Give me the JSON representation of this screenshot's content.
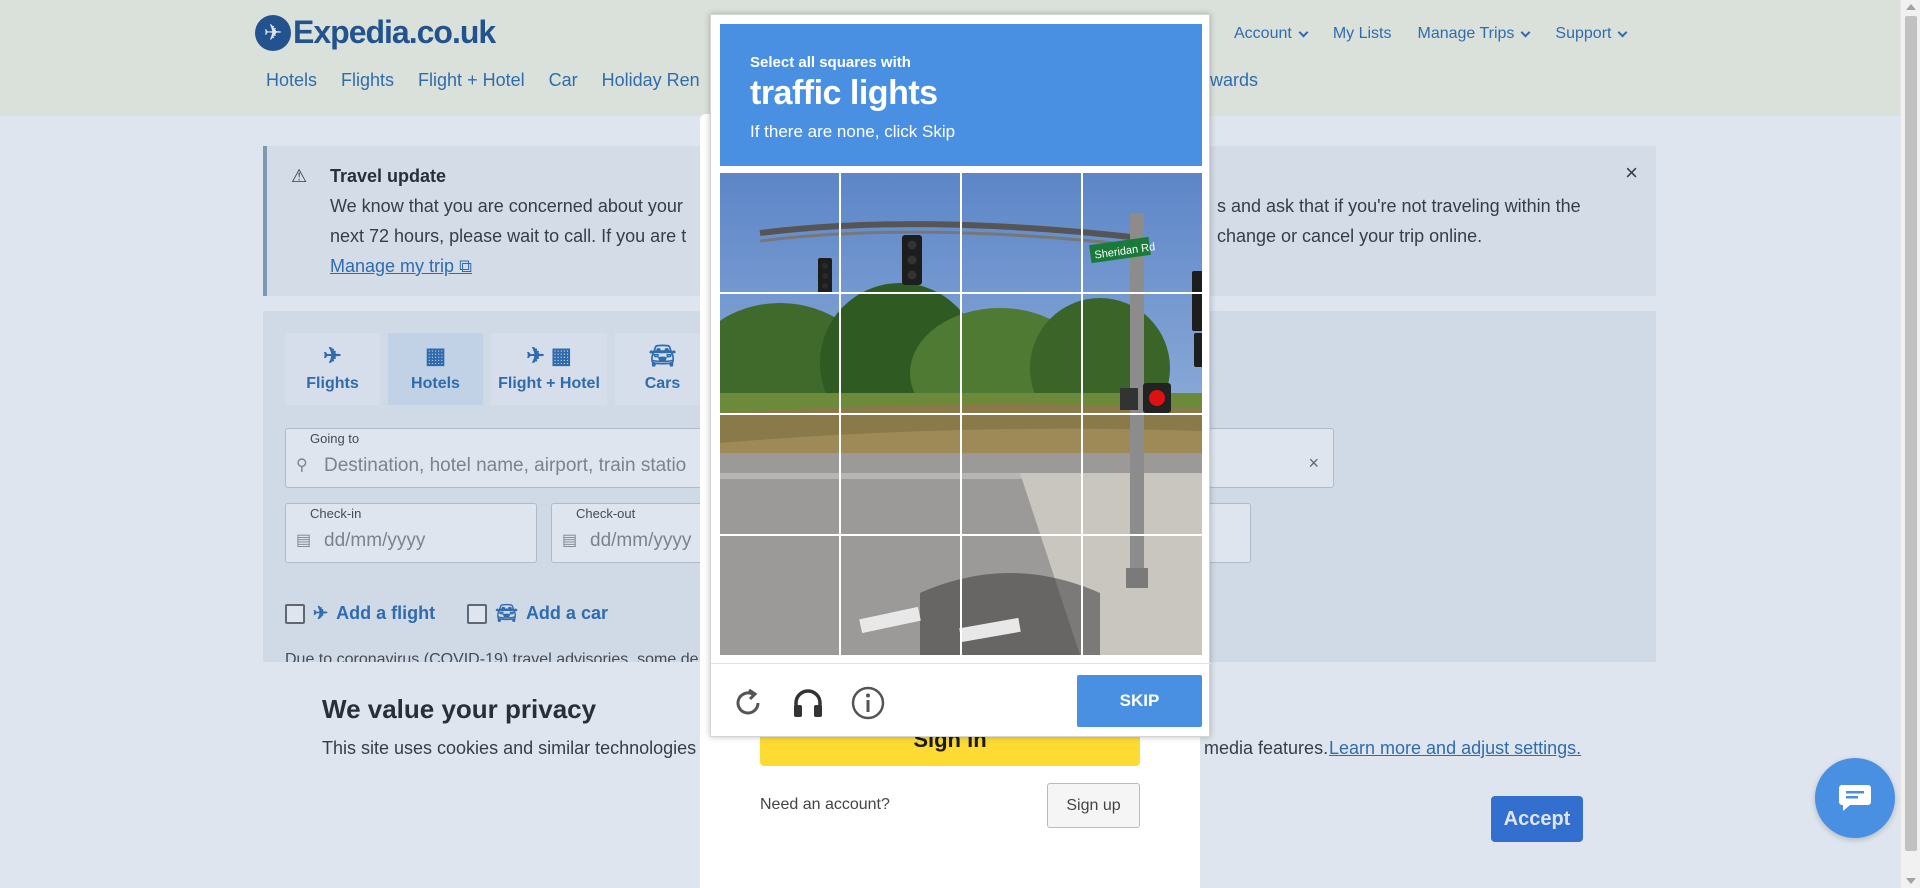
{
  "header": {
    "logo_text": "Expedia.co.uk",
    "links": {
      "account": "Account",
      "my_lists": "My Lists",
      "manage_trips": "Manage Trips",
      "support": "Support"
    },
    "nav": {
      "hotels": "Hotels",
      "flights": "Flights",
      "flight_hotel": "Flight + Hotel",
      "car": "Car",
      "holiday_rentals": "Holiday Ren",
      "rewards": "ewards"
    }
  },
  "travel_update": {
    "icon": "warning-icon",
    "title": "Travel update",
    "body_line1_a": "We know that you are concerned about your",
    "body_line1_b": "s and ask that if you're not traveling within the",
    "body_line2_a": "next 72 hours, please wait to call. If you are t",
    "body_line2_b": "change or cancel your trip online.",
    "link": "Manage my trip",
    "close": "×"
  },
  "search": {
    "tabs": {
      "flights": "Flights",
      "hotels": "Hotels",
      "flight_hotel": "Flight + Hotel",
      "cars": "Cars"
    },
    "going_to_label": "Going to",
    "going_to_placeholder": "Destination, hotel name, airport, train statio",
    "checkin_label": "Check-in",
    "checkin_placeholder": "dd/mm/yyyy",
    "checkout_label": "Check-out",
    "checkout_placeholder": "dd/mm/yyyy",
    "add_flight": "Add a flight",
    "add_car": "Add a car",
    "covid_text": "Due to coronavirus (COVID-19) travel advisories, some de"
  },
  "privacy": {
    "title": "We value your privacy",
    "text": "This site uses cookies and similar technologies t",
    "text2": "media features.",
    "link": "Learn more and adjust settings.",
    "accept": "Accept"
  },
  "signin": {
    "button": "Sign in",
    "need_account": "Need an account?",
    "signup": "Sign up"
  },
  "captcha": {
    "instruction_line1": "Select all squares with",
    "target": "traffic lights",
    "instruction_line3": "If there are none, click Skip",
    "street_sign": "Sheridan Rd",
    "skip": "SKIP",
    "icons": [
      "refresh-icon",
      "audio-headphones-icon",
      "info-icon"
    ],
    "colors": {
      "header": "#4a90e2",
      "skip": "#4a90e2"
    }
  },
  "chat": {
    "icon": "chat-bubble-icon"
  }
}
